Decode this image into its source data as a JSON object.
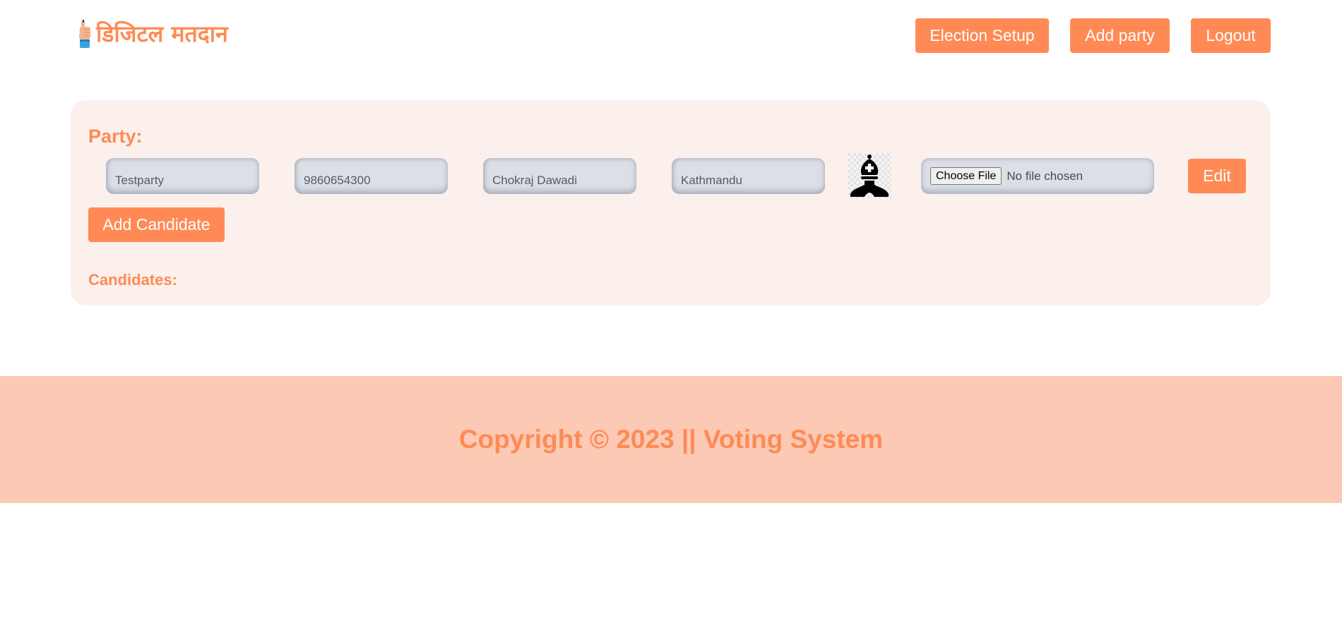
{
  "brand": {
    "title": "डिजिटल मतदान",
    "icon": "voting-finger-icon"
  },
  "nav": {
    "election_setup": "Election Setup",
    "add_party": "Add party",
    "logout": "Logout"
  },
  "colors": {
    "accent": "#ff8a55",
    "card_background": "#fbf0ec",
    "footer_background": "#fcc9b4",
    "field_background": "#dcdfe5"
  },
  "party": {
    "heading": "Party:",
    "name_value": "Testparty",
    "phone_value": "9860654300",
    "leader_value": "Chokraj Dawadi",
    "location_value": "Kathmandu",
    "symbol_icon": "chess-bishop-icon",
    "file_button": "Choose File",
    "file_status": "No file chosen",
    "edit_label": "Edit"
  },
  "actions": {
    "add_candidate": "Add Candidate"
  },
  "candidates": {
    "heading": "Candidates:"
  },
  "footer": {
    "copyright": "Copyright © 2023 || Voting System"
  }
}
